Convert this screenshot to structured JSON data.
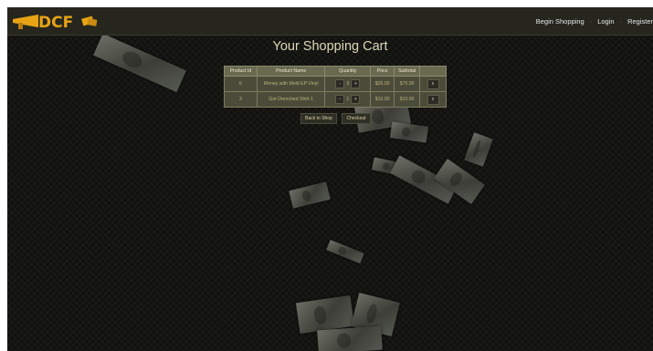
{
  "navbar": {
    "links": [
      {
        "label": "Begin Shopping"
      },
      {
        "label": "Login"
      },
      {
        "label": "Register"
      }
    ]
  },
  "title": "Your Shopping Cart",
  "table": {
    "headers": [
      "Product Id",
      "Product Name",
      "Quantity",
      "Price",
      "Subtotal",
      ""
    ],
    "rows": [
      {
        "id": "6",
        "name": "Money with Mold EP Vinyl",
        "qty": "3",
        "price": "$25.00",
        "subtotal": "$75.00"
      },
      {
        "id": "3",
        "name": "Get Drenched Shirt 1",
        "qty": "1",
        "price": "$10.00",
        "subtotal": "$10.00"
      }
    ],
    "minus": "-",
    "plus": "+",
    "remove": "x"
  },
  "buttons": {
    "back": "Back to Shop",
    "checkout": "Checkout"
  },
  "colors": {
    "background": "#151512",
    "navbar": "#26261f",
    "logo": "#e8a414",
    "table_header": "#6a6a50",
    "table_body": "#4b4b3a"
  }
}
